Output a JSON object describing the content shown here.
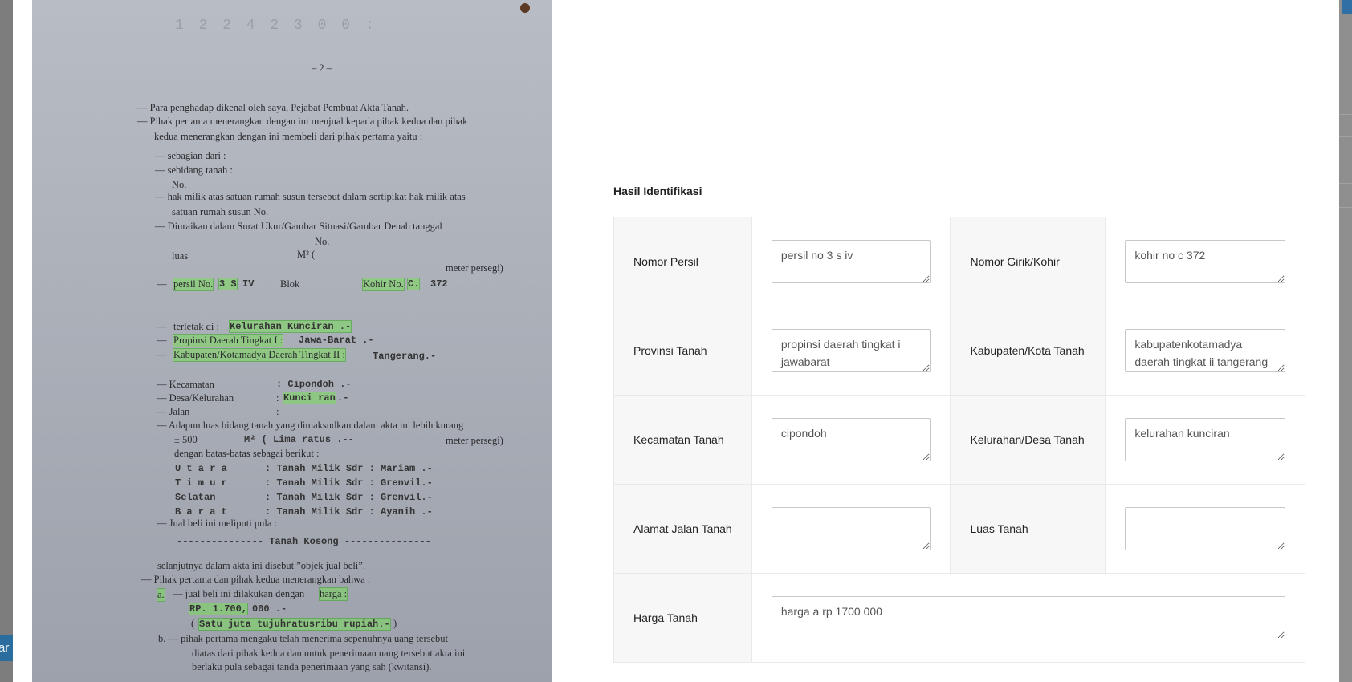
{
  "background": {
    "left_button_label": "ar"
  },
  "document": {
    "faded_header": "1 2 2 4 2 3 0 0 :",
    "page_number": "– 2 –",
    "lines": [
      {
        "t": "—   Para penghadap dikenal oleh saya, Pejabat Pembuat Akta Tanah."
      },
      {
        "t": "—   Pihak pertama menerangkan dengan ini menjual kepada pihak kedua dan pihak"
      },
      {
        "t": "kedua menerangkan dengan ini membeli dari pihak pertama yaitu :"
      },
      {
        "t": "—   sebagian dari      :"
      },
      {
        "t": "—   sebidang tanah    :"
      },
      {
        "t": "No."
      },
      {
        "t": "—   hak milik atas satuan rumah susun tersebut dalam sertipikat hak milik atas"
      },
      {
        "t": "satuan rumah susun No."
      },
      {
        "t": "—   Diuraikan dalam Surat Ukur/Gambar Situasi/Gambar Denah tanggal"
      },
      {
        "t": "No."
      },
      {
        "t": "luas"
      },
      {
        "t": "M²  ("
      },
      {
        "t": "meter persegi)"
      },
      {
        "t": "—"
      },
      {
        "t": "persil No."
      },
      {
        "t": "3 S"
      },
      {
        "t": "IV"
      },
      {
        "t": "Blok"
      },
      {
        "t": "Kohir No."
      },
      {
        "t": "C."
      },
      {
        "t": "372"
      },
      {
        "t": "—"
      },
      {
        "t": "terletak di :"
      },
      {
        "t": "Kelurahan Kunciran .-"
      },
      {
        "t": "—"
      },
      {
        "t": "Propinsi Daerah Tingkat I :"
      },
      {
        "t": "Jawa-Barat .-"
      },
      {
        "t": "—"
      },
      {
        "t": "Kabupaten/Kotamadya Daerah Tingkat II :"
      },
      {
        "t": "Tangerang.-"
      },
      {
        "t": "—   Kecamatan"
      },
      {
        "t": ": Cipondoh .-"
      },
      {
        "t": "—   Desa/Kelurahan"
      },
      {
        "t": ":"
      },
      {
        "t": "Kunci ran"
      },
      {
        "t": ".-"
      },
      {
        "t": "—   Jalan"
      },
      {
        "t": ":"
      },
      {
        "t": "—   Adapun luas bidang tanah yang dimaksudkan dalam akta ini lebih kurang"
      },
      {
        "t": "± 500"
      },
      {
        "t": "M² ( Lima ratus .--"
      },
      {
        "t": "meter persegi)"
      },
      {
        "t": "dengan batas-batas sebagai berikut :"
      },
      {
        "t": "U t a r a"
      },
      {
        "t": ": Tanah Milik Sdr : Mariam .-"
      },
      {
        "t": "T i m u r"
      },
      {
        "t": ": Tanah Milik Sdr : Grenvil.-"
      },
      {
        "t": "Selatan"
      },
      {
        "t": ": Tanah Milik Sdr : Grenvil.-"
      },
      {
        "t": "B a r a t"
      },
      {
        "t": ": Tanah Milik Sdr : Ayanih .-"
      },
      {
        "t": "—   Jual beli ini meliputi pula :"
      },
      {
        "t": "--------------- Tanah Kosong ---------------"
      },
      {
        "t": "selanjutnya dalam akta ini disebut ”objek jual beli”."
      },
      {
        "t": "—   Pihak pertama dan pihak kedua menerangkan bahwa :"
      },
      {
        "t": "a."
      },
      {
        "t": "—   jual beli ini dilakukan dengan"
      },
      {
        "t": "harga :"
      },
      {
        "t": "RP. 1.700,"
      },
      {
        "t": "000 .-"
      },
      {
        "t": "("
      },
      {
        "t": "Satu juta tujuhratusribu rupiah.-"
      },
      {
        "t": ")"
      },
      {
        "t": "b.   —   pihak pertama mengaku telah menerima sepenuhnya uang tersebut"
      },
      {
        "t": "diatas dari pihak kedua dan untuk penerimaan uang tersebut akta ini"
      },
      {
        "t": "berlaku pula sebagai tanda penerimaan yang sah (kwitansi)."
      }
    ]
  },
  "form": {
    "title": "Hasil Identifikasi",
    "fields": {
      "nomor_persil": {
        "label": "Nomor Persil",
        "value": "persil no 3 s iv"
      },
      "nomor_girik": {
        "label": "Nomor Girik/Kohir",
        "value": "kohir no c 372"
      },
      "provinsi": {
        "label": "Provinsi Tanah",
        "value": "propinsi daerah tingkat i jawabarat"
      },
      "kabupaten": {
        "label": "Kabupaten/Kota Tanah",
        "value": "kabupatenkotamadya daerah tingkat ii tangerang"
      },
      "kecamatan": {
        "label": "Kecamatan Tanah",
        "value": "cipondoh"
      },
      "kelurahan": {
        "label": "Kelurahan/Desa Tanah",
        "value": "kelurahan kunciran"
      },
      "alamat": {
        "label": "Alamat Jalan Tanah",
        "value": ""
      },
      "luas": {
        "label": "Luas Tanah",
        "value": ""
      },
      "harga": {
        "label": "Harga Tanah",
        "value": "harga a rp 1700 000"
      }
    }
  }
}
